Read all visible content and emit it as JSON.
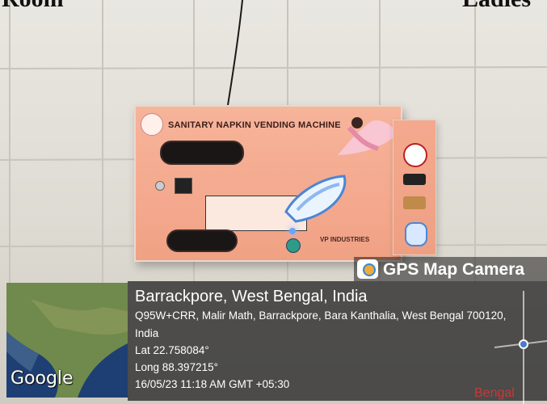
{
  "top_text": {
    "left": "Room",
    "right": "Ladies"
  },
  "machine": {
    "title": "SANITARY NAPKIN VENDING MACHINE",
    "brand": "VP INDUSTRIES",
    "brand_color": "#f4a98e"
  },
  "gps_camera": {
    "label": "GPS Map Camera"
  },
  "location": {
    "title": "Barrackpore, West Bengal, India",
    "address": "Q95W+CRR, Malir Math, Barrackpore, Bara Kanthalia, West Bengal 700120,",
    "country": "India",
    "lat": "Lat 22.758084°",
    "long": "Long 88.397215°",
    "timestamp": "16/05/23 11:18 AM GMT +05:30"
  },
  "map": {
    "provider": "Google",
    "place_label": "Bengal"
  },
  "colors": {
    "overlay": "#262626",
    "text": "#ffffff",
    "accent_red": "#c53a3a"
  }
}
